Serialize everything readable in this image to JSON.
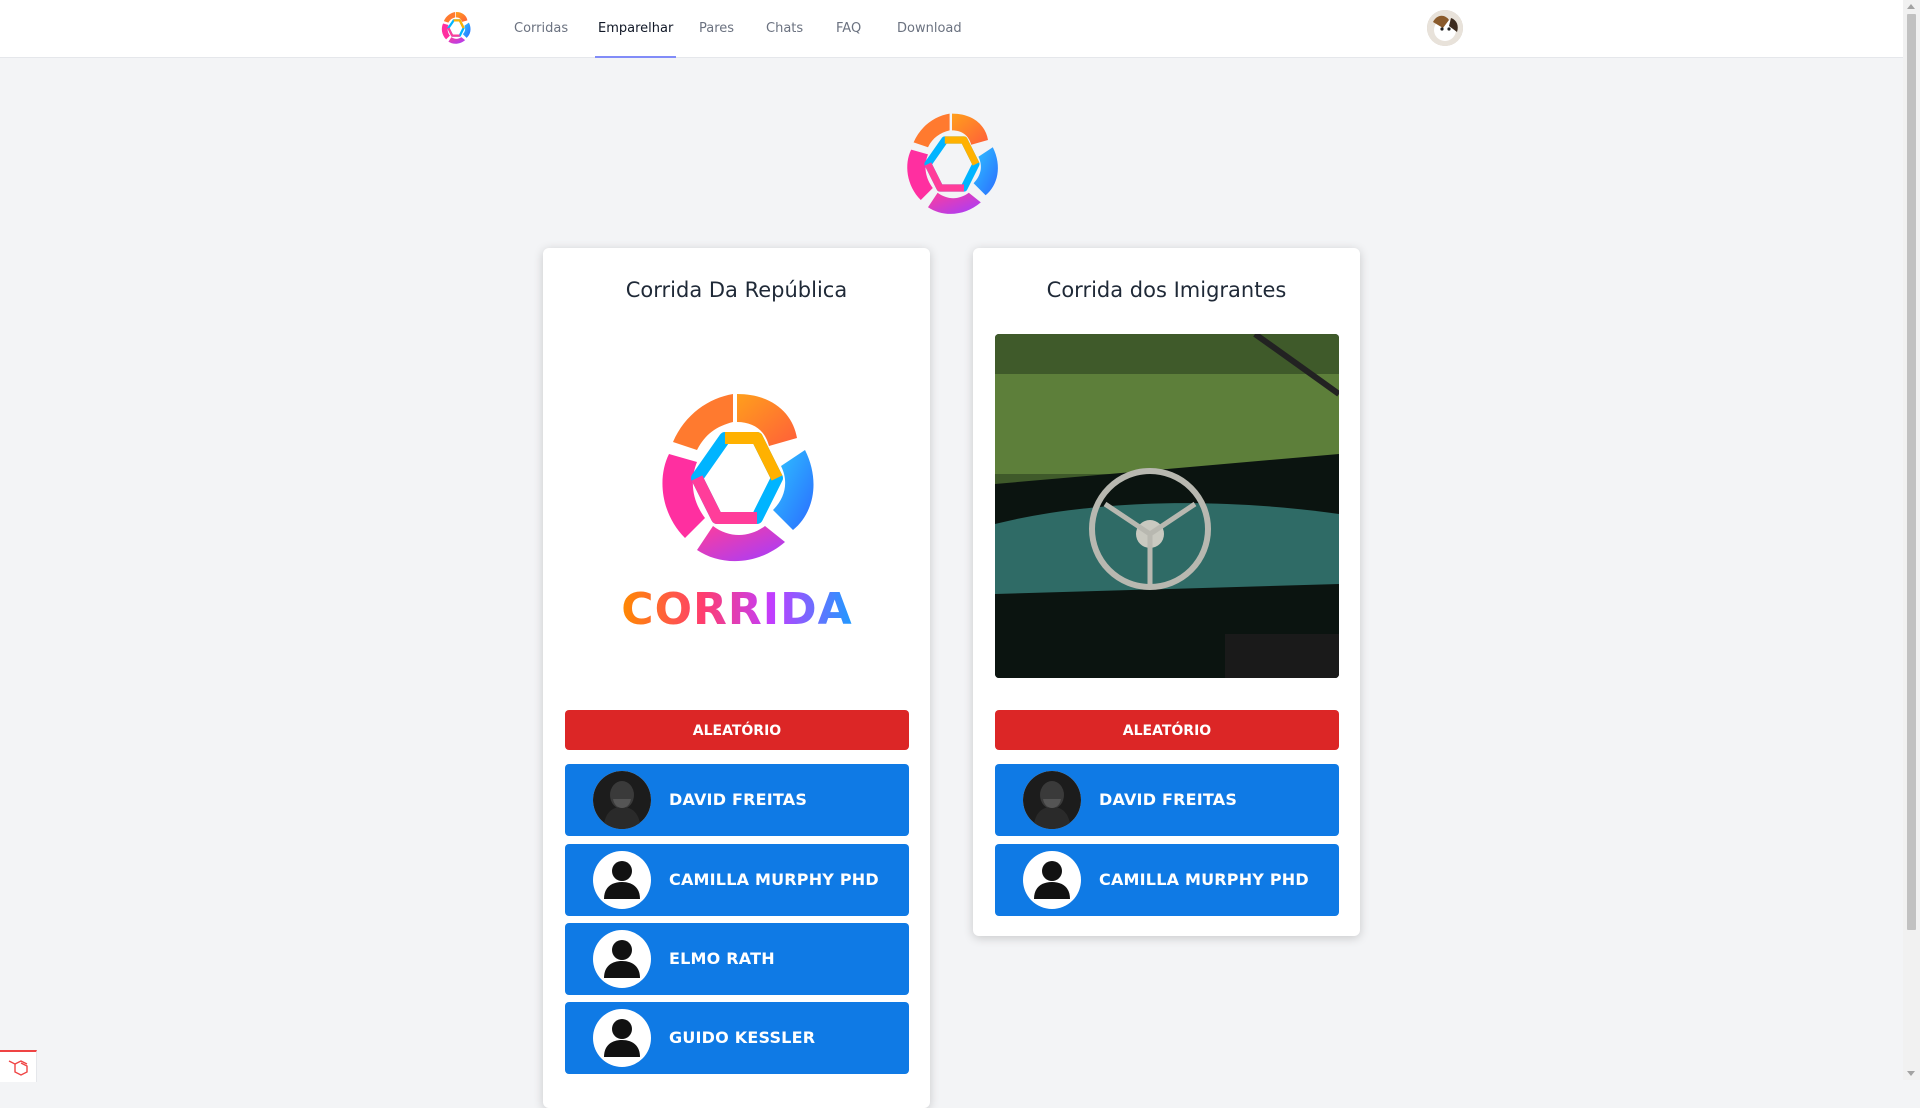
{
  "nav": {
    "links": [
      {
        "label": "Corridas",
        "active": false
      },
      {
        "label": "Emparelhar",
        "active": true
      },
      {
        "label": "Pares",
        "active": false
      },
      {
        "label": "Chats",
        "active": false
      },
      {
        "label": "FAQ",
        "active": false
      },
      {
        "label": "Download",
        "active": false
      }
    ]
  },
  "colors": {
    "random_button": "#dc2626",
    "person_button": "#0f7ae5",
    "active_tab_underline": "#818cf8",
    "page_background": "#f3f4f6"
  },
  "races": [
    {
      "title": "Corrida Da República",
      "media": {
        "type": "logo",
        "wordmark": "CORRIDA"
      },
      "random_label": "ALEATÓRIO",
      "people": [
        {
          "name": "DAVID FREITAS",
          "avatar": "photo"
        },
        {
          "name": "CAMILLA MURPHY PHD",
          "avatar": "default-user-icon"
        },
        {
          "name": "ELMO RATH",
          "avatar": "default-user-icon"
        },
        {
          "name": "GUIDO KESSLER",
          "avatar": "default-user-icon"
        }
      ]
    },
    {
      "title": "Corrida dos Imigrantes",
      "media": {
        "type": "photo",
        "subject": "vintage car steering wheel"
      },
      "random_label": "ALEATÓRIO",
      "people": [
        {
          "name": "DAVID FREITAS",
          "avatar": "photo"
        },
        {
          "name": "CAMILLA MURPHY PHD",
          "avatar": "default-user-icon"
        }
      ]
    }
  ]
}
